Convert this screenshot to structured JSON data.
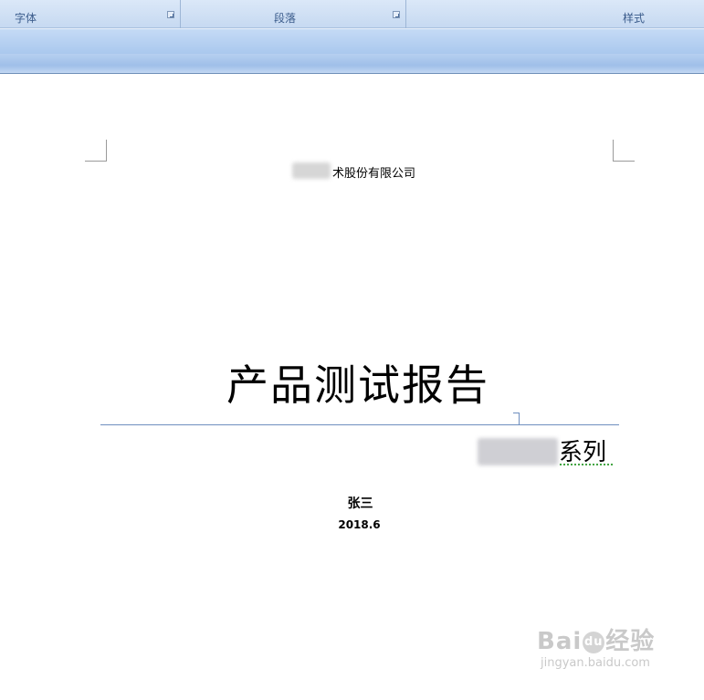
{
  "ribbon": {
    "groups": [
      {
        "label": "字体"
      },
      {
        "label": "段落"
      },
      {
        "label": "样式"
      }
    ]
  },
  "document": {
    "company_suffix": "术股份有限公司",
    "title": "产品测试报告",
    "subtitle_suffix": "系列",
    "author": "张三",
    "date": "2018.6"
  },
  "watermark": {
    "logo_left": "Bai",
    "logo_paw": "du",
    "logo_right": "经验",
    "url": "jingyan.baidu.com"
  }
}
